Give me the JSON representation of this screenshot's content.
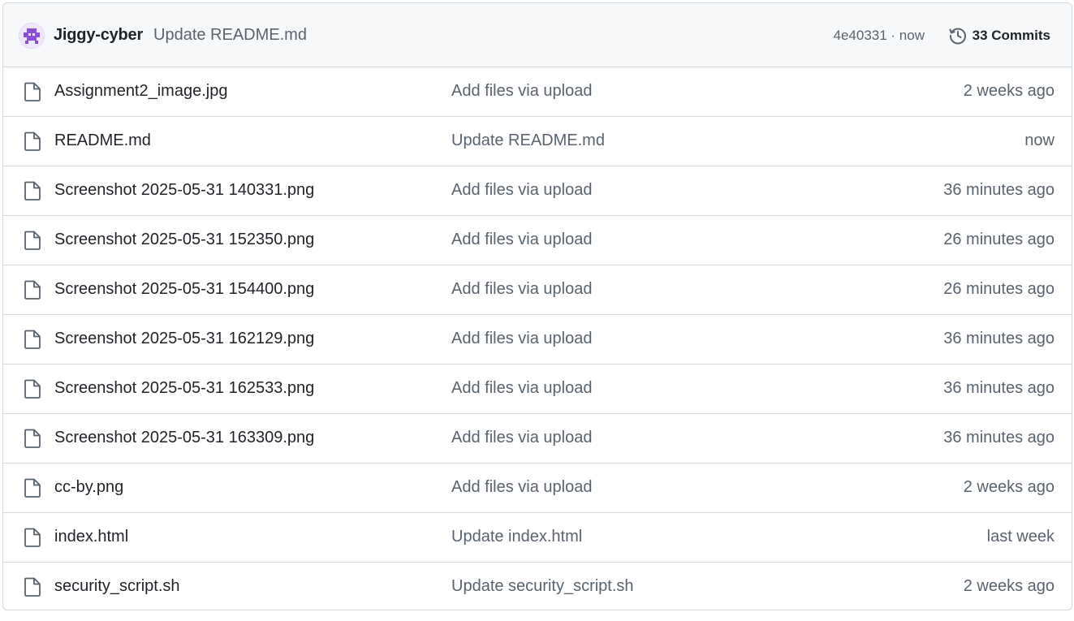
{
  "latest_commit": {
    "author": "Jiggy-cyber",
    "message": "Update README.md",
    "hash_time": "4e40331 · now",
    "commits_label": "33 Commits",
    "avatar_icon": "identicon-avatar",
    "history_icon": "history-icon"
  },
  "colors": {
    "accent_avatar": "#8a4fd8",
    "muted_text": "#59636e",
    "border": "#d1d9e0",
    "header_bg": "#f6f8fa"
  },
  "files": [
    {
      "name": "Assignment2_image.jpg",
      "message": "Add files via upload",
      "time": "2 weeks ago",
      "icon": "file-icon"
    },
    {
      "name": "README.md",
      "message": "Update README.md",
      "time": "now",
      "icon": "file-icon"
    },
    {
      "name": "Screenshot 2025-05-31 140331.png",
      "message": "Add files via upload",
      "time": "36 minutes ago",
      "icon": "file-icon"
    },
    {
      "name": "Screenshot 2025-05-31 152350.png",
      "message": "Add files via upload",
      "time": "26 minutes ago",
      "icon": "file-icon"
    },
    {
      "name": "Screenshot 2025-05-31 154400.png",
      "message": "Add files via upload",
      "time": "26 minutes ago",
      "icon": "file-icon"
    },
    {
      "name": "Screenshot 2025-05-31 162129.png",
      "message": "Add files via upload",
      "time": "36 minutes ago",
      "icon": "file-icon"
    },
    {
      "name": "Screenshot 2025-05-31 162533.png",
      "message": "Add files via upload",
      "time": "36 minutes ago",
      "icon": "file-icon"
    },
    {
      "name": "Screenshot 2025-05-31 163309.png",
      "message": "Add files via upload",
      "time": "36 minutes ago",
      "icon": "file-icon"
    },
    {
      "name": "cc-by.png",
      "message": "Add files via upload",
      "time": "2 weeks ago",
      "icon": "file-icon"
    },
    {
      "name": "index.html",
      "message": "Update index.html",
      "time": "last week",
      "icon": "file-icon"
    },
    {
      "name": "security_script.sh",
      "message": "Update security_script.sh",
      "time": "2 weeks ago",
      "icon": "file-icon"
    }
  ]
}
